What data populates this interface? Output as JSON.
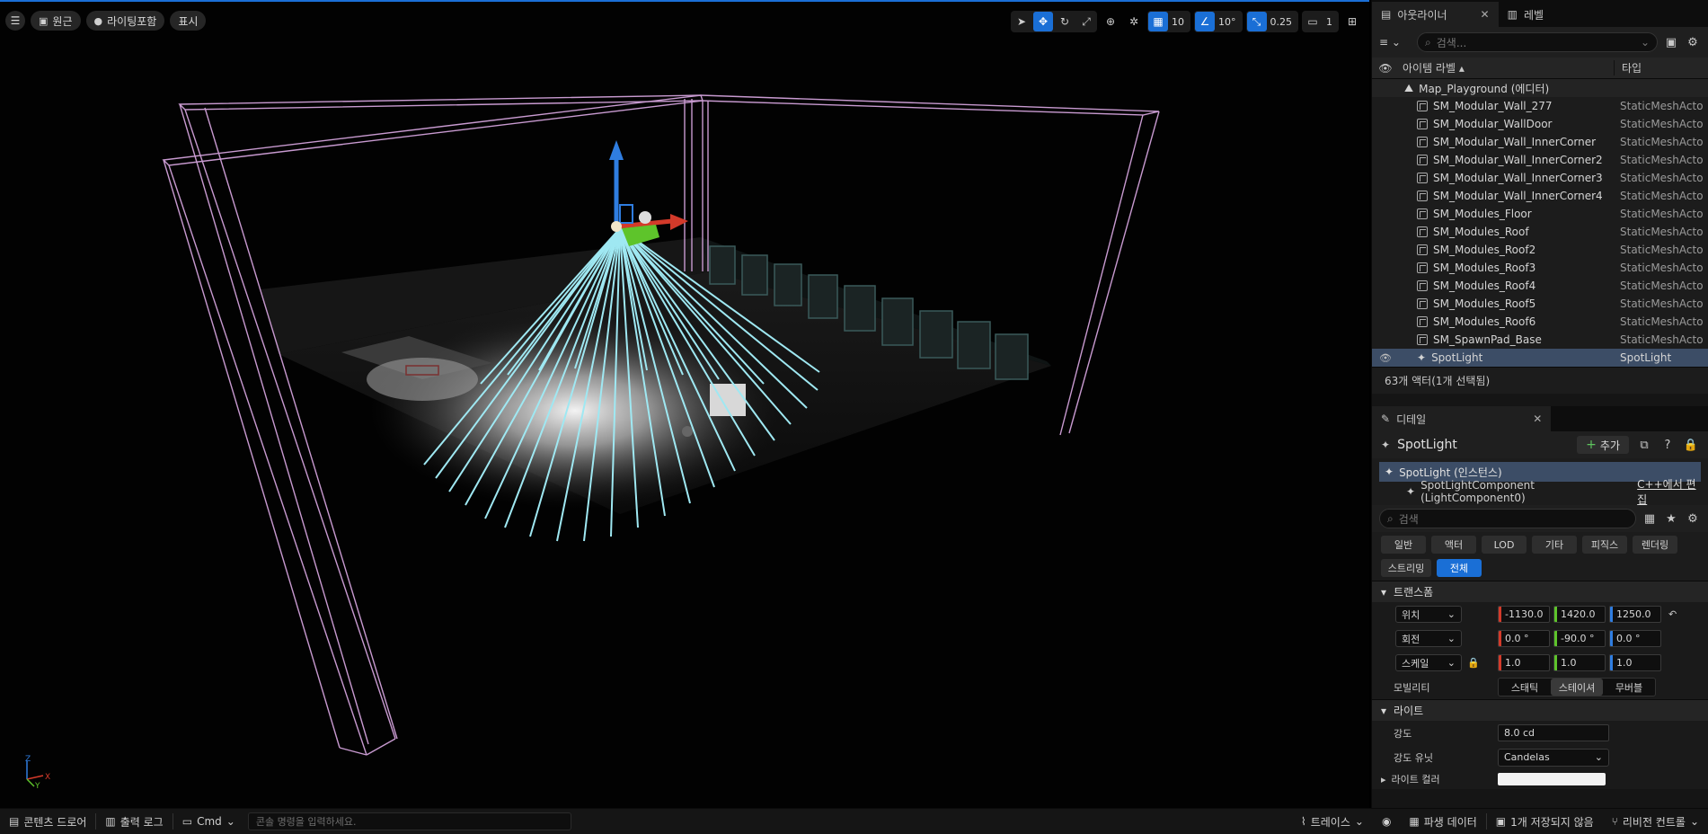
{
  "viewport": {
    "menu_icon": "hamburger-icon",
    "perspective_label": "원근",
    "lighting_label": "라이팅포함",
    "show_label": "표시",
    "grid_snap_value": "10",
    "rotate_snap_value": "10°",
    "scale_snap_value": "0.25",
    "camera_speed_value": "1",
    "axis": {
      "x": "X",
      "y": "Y",
      "z": "Z"
    }
  },
  "outliner": {
    "tab_label": "아웃라이너",
    "levels_tab_label": "레벨",
    "search_placeholder": "검색...",
    "col_label": "아이템 라벨 ▴",
    "col_type": "타입",
    "map_row": "Map_Playground (에디터)",
    "rows": [
      {
        "name": "SM_Modular_Wall_277",
        "type": "StaticMeshActo"
      },
      {
        "name": "SM_Modular_WallDoor",
        "type": "StaticMeshActo"
      },
      {
        "name": "SM_Modular_Wall_InnerCorner",
        "type": "StaticMeshActo"
      },
      {
        "name": "SM_Modular_Wall_InnerCorner2",
        "type": "StaticMeshActo"
      },
      {
        "name": "SM_Modular_Wall_InnerCorner3",
        "type": "StaticMeshActo"
      },
      {
        "name": "SM_Modular_Wall_InnerCorner4",
        "type": "StaticMeshActo"
      },
      {
        "name": "SM_Modules_Floor",
        "type": "StaticMeshActo"
      },
      {
        "name": "SM_Modules_Roof",
        "type": "StaticMeshActo"
      },
      {
        "name": "SM_Modules_Roof2",
        "type": "StaticMeshActo"
      },
      {
        "name": "SM_Modules_Roof3",
        "type": "StaticMeshActo"
      },
      {
        "name": "SM_Modules_Roof4",
        "type": "StaticMeshActo"
      },
      {
        "name": "SM_Modules_Roof5",
        "type": "StaticMeshActo"
      },
      {
        "name": "SM_Modules_Roof6",
        "type": "StaticMeshActo"
      },
      {
        "name": "SM_SpawnPad_Base",
        "type": "StaticMeshActo"
      }
    ],
    "selected_row": {
      "name": "SpotLight",
      "type": "SpotLight"
    },
    "status": "63개 액터(1개 선택됨)"
  },
  "details": {
    "tab_label": "디테일",
    "actor_name": "SpotLight",
    "add_label": "추가",
    "instance_label": "SpotLight (인스턴스)",
    "component_label": "SpotLightComponent (LightComponent0)",
    "cpp_edit_label": "C++에서 편집",
    "search_placeholder": "검색",
    "filters": [
      "일반",
      "액터",
      "LOD",
      "기타",
      "피직스",
      "렌더링",
      "스트리밍",
      "전체"
    ],
    "active_filter": "전체",
    "transform_section": "트랜스폼",
    "location": {
      "label": "위치",
      "x": "-1130.0",
      "y": "1420.0",
      "z": "1250.0"
    },
    "rotation": {
      "label": "회전",
      "x": "0.0 °",
      "y": "-90.0 °",
      "z": "0.0 °"
    },
    "scale": {
      "label": "스케일",
      "x": "1.0",
      "y": "1.0",
      "z": "1.0"
    },
    "mobility": {
      "label": "모빌리티",
      "options": [
        "스태틱",
        "스테이셔",
        "무버블"
      ],
      "selected": "스테이셔"
    },
    "light_section": "라이트",
    "intensity": {
      "label": "강도",
      "value": "8.0 cd"
    },
    "intensity_unit": {
      "label": "강도 유닛",
      "value": "Candelas"
    },
    "light_color": {
      "label": "라이트 컬러",
      "value": "#ffffff"
    }
  },
  "bottombar": {
    "content_drawer": "콘텐츠 드로어",
    "output_log": "출력 로그",
    "cmd": "Cmd",
    "console_placeholder": "콘솔 명령을 입력하세요.",
    "trace": "트레이스",
    "derived_data": "파생 데이터",
    "unsaved": "1개 저장되지 않음",
    "revision": "리비전 컨트롤"
  },
  "colors": {
    "accent": "#1a6fd6",
    "selection": "#3c4d66",
    "cone_lines": "#9fe8f2",
    "bounds": "#c89ad0",
    "axis_x": "#d33a2a",
    "axis_y": "#5ec42b",
    "axis_z": "#2f7de0"
  }
}
